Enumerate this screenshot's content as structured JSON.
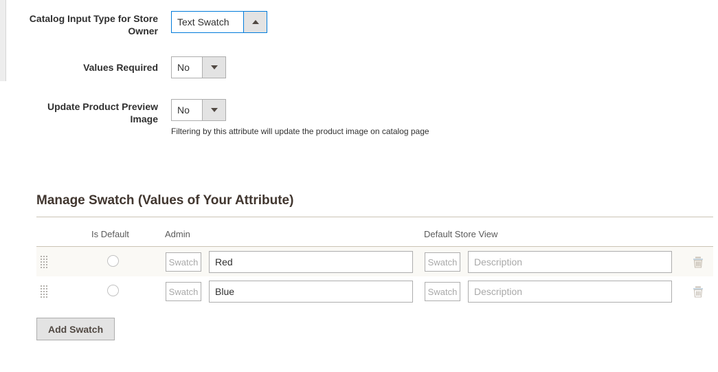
{
  "form": {
    "fields": [
      {
        "label": "Catalog Input Type for Store Owner",
        "value": "Text Swatch",
        "state": "open",
        "note": ""
      },
      {
        "label": "Values Required",
        "value": "No",
        "state": "closed",
        "note": ""
      },
      {
        "label": "Update Product Preview Image",
        "value": "No",
        "state": "closed",
        "note": "Filtering by this attribute will update the product image on catalog page"
      }
    ]
  },
  "section": {
    "title": "Manage Swatch (Values of Your Attribute)",
    "table": {
      "headers": {
        "is_default": "Is Default",
        "admin": "Admin",
        "default_store_view": "Default Store View"
      },
      "rows": [
        {
          "drag_handle": "drag-handle-icon",
          "is_default_checked": false,
          "admin_swatch_label": "Swatch",
          "admin_value": "Red",
          "store_swatch_label": "Swatch",
          "store_value": "",
          "store_placeholder": "Description",
          "delete_icon": "trash-icon"
        },
        {
          "drag_handle": "drag-handle-icon",
          "is_default_checked": false,
          "admin_swatch_label": "Swatch",
          "admin_value": "Blue",
          "store_swatch_label": "Swatch",
          "store_value": "",
          "store_placeholder": "Description",
          "delete_icon": "trash-icon"
        }
      ]
    },
    "add_swatch_label": "Add Swatch"
  },
  "colors": {
    "focus_border": "#007bdb",
    "heading": "#41362f",
    "divider": "#cac3b4",
    "row_tint": "#faf9f5",
    "button_face": "#e3e3e3"
  }
}
